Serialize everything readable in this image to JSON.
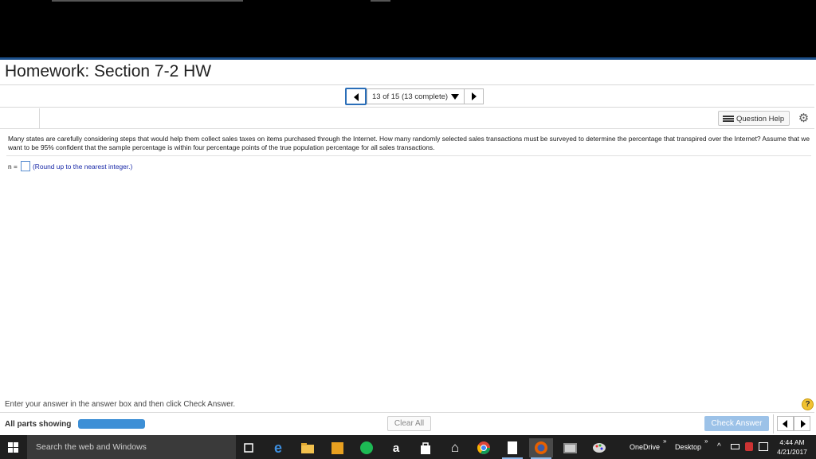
{
  "header": {
    "title": "Homework: Section 7-2 HW"
  },
  "nav": {
    "position": "13 of 15 (13 complete)"
  },
  "toolbar": {
    "question_help": "Question Help",
    "settings_icon": "gear-icon"
  },
  "question": {
    "text": "Many states are carefully considering steps that would help them collect sales taxes on items purchased through the Internet. How many randomly selected sales transactions must be surveyed to determine the percentage that transpired over the Internet? Assume that we want to be 95% confident that the sample percentage is within four percentage points of the true population percentage for all sales transactions.",
    "answer_label": "n =",
    "answer_value": "",
    "answer_hint": "(Round up to the nearest integer.)"
  },
  "footer": {
    "instructions": "Enter your answer in the answer box and then click Check Answer.",
    "info_label": "?",
    "parts_label": "All parts showing",
    "progress_fraction": 1.0,
    "clear_all": "Clear All",
    "check_answer": "Check Answer"
  },
  "taskbar": {
    "search_placeholder": "Search the web and Windows",
    "onedrive": "OneDrive",
    "desktop": "Desktop",
    "time": "4:44 AM",
    "date": "4/21/2017"
  },
  "colors": {
    "accent": "#1b4f8a",
    "progress": "#3d8fd6",
    "check_answer_bg": "#9cc2e8",
    "hint_text": "#1a2aa8"
  }
}
